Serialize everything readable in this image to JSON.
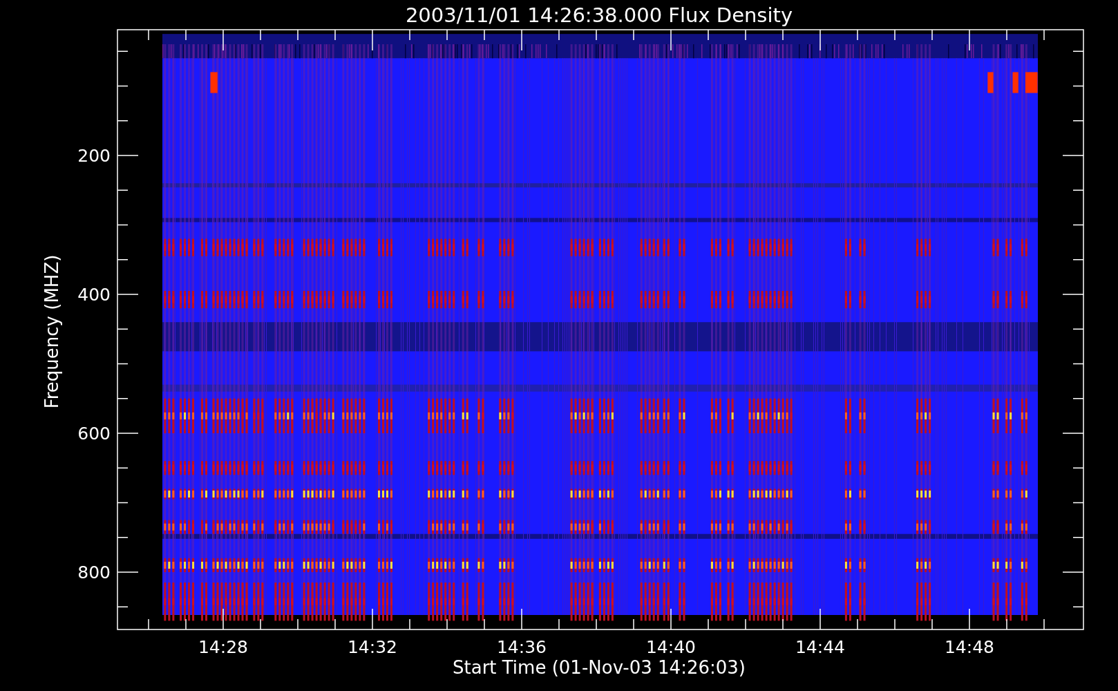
{
  "title": "2003/11/01 14:26:38.000 Flux Density",
  "y_axis": {
    "label": "Frequency (MHZ)",
    "ticks": [
      "200",
      "400",
      "600",
      "800"
    ]
  },
  "x_axis": {
    "label": "Start Time (01-Nov-03 14:26:03)",
    "ticks": [
      "14:28",
      "14:32",
      "14:36",
      "14:40",
      "14:44",
      "14:48"
    ]
  }
}
